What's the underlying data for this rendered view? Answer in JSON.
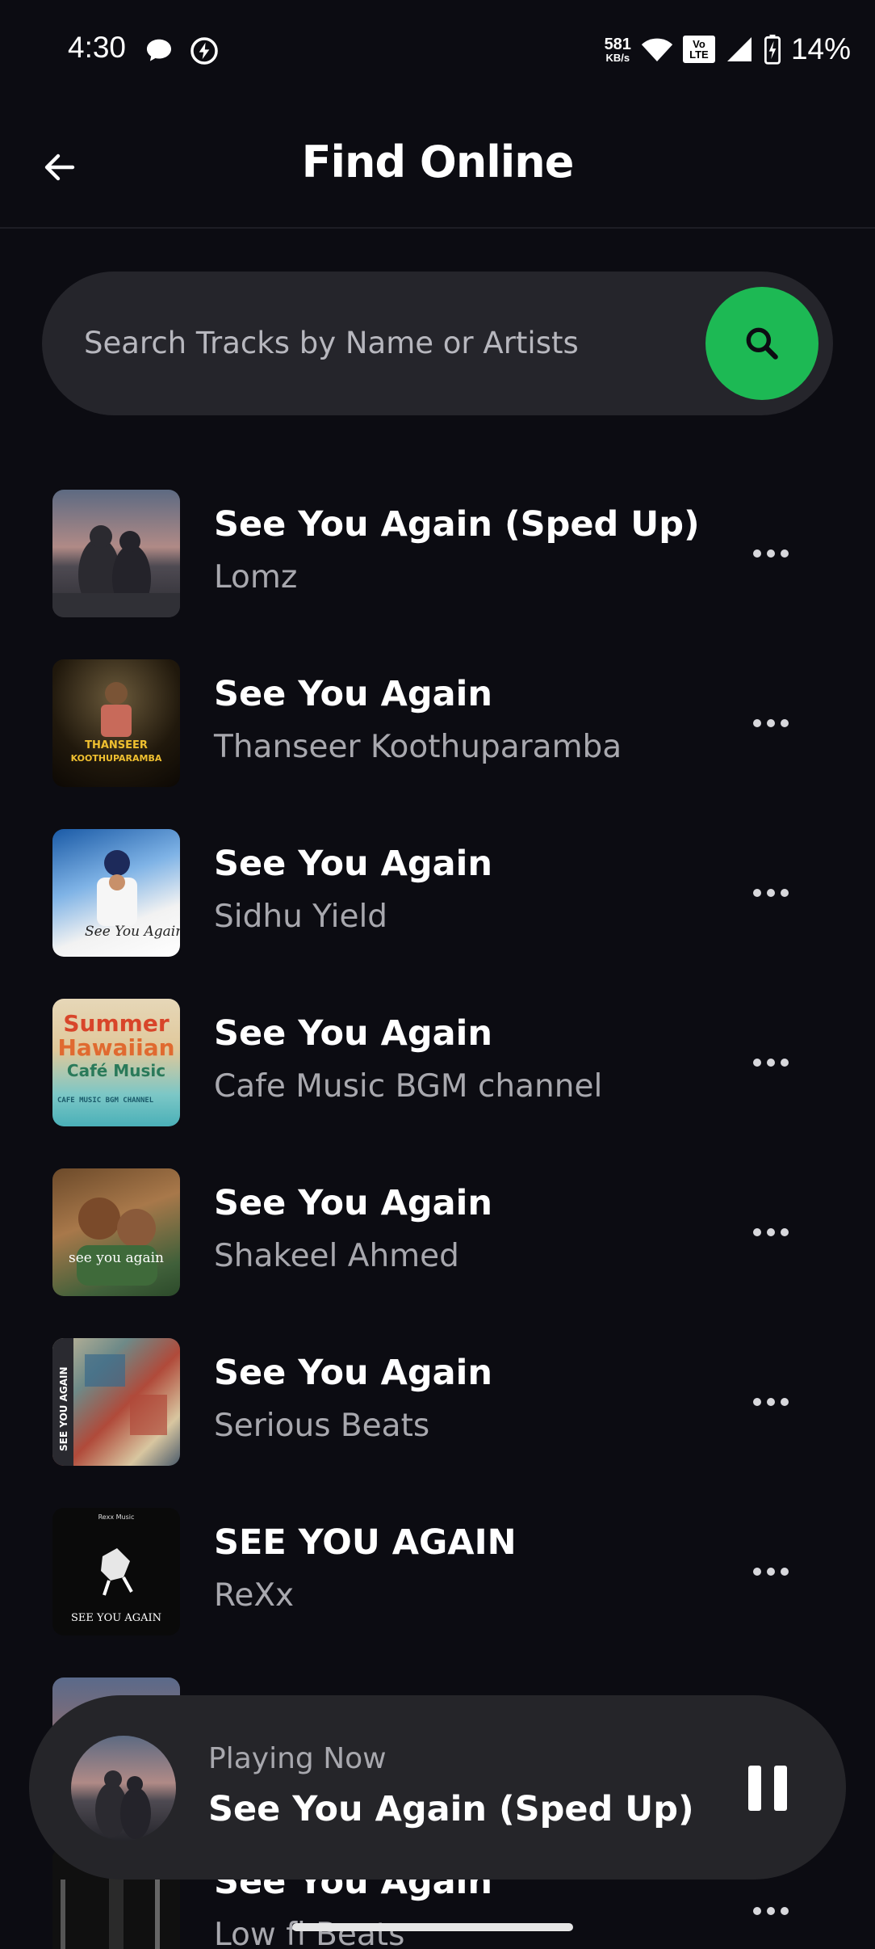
{
  "status_bar": {
    "time": "4:30",
    "net_speed_value": "581",
    "net_speed_unit": "KB/s",
    "volte_top": "Vo",
    "volte_bottom": "LTE",
    "battery_percent": "14%",
    "icons": [
      "chat-bubble-icon",
      "bolt-circle-icon",
      "wifi-icon",
      "volte-icon",
      "cell-signal-icon",
      "battery-charging-icon"
    ]
  },
  "header": {
    "title": "Find Online",
    "back_icon": "arrow-left-icon"
  },
  "search": {
    "placeholder": "Search Tracks by Name or Artists",
    "value": "",
    "button_icon": "search-icon",
    "accent_color": "#1db954"
  },
  "tracks": [
    {
      "title": "See You Again (Sped Up)",
      "artist": "Lomz"
    },
    {
      "title": "See You Again",
      "artist": "Thanseer Koothuparamba"
    },
    {
      "title": "See You Again",
      "artist": "Sidhu Yield"
    },
    {
      "title": "See You Again",
      "artist": "Cafe Music BGM channel"
    },
    {
      "title": "See You Again",
      "artist": "Shakeel Ahmed"
    },
    {
      "title": "See You Again",
      "artist": "Serious Beats"
    },
    {
      "title": "SEE YOU AGAIN",
      "artist": "ReXx"
    },
    {
      "title": "",
      "artist": ""
    },
    {
      "title": "See You Again",
      "artist": "Low fi Beats"
    }
  ],
  "album_art_text": {
    "art2_top": "THANSEER",
    "art2_bottom": "KOOTHUPARAMBA",
    "art3": "See You Again",
    "art4_line1": "Summer",
    "art4_line2": "Hawaiian",
    "art4_line3": "Café Music",
    "art4_small": "CAFE MUSIC BGM CHANNEL",
    "art5": "see you again",
    "art6": "SEE YOU AGAIN",
    "art7_top": "Rexx Music",
    "art7_bottom": "SEE YOU AGAIN"
  },
  "now_playing": {
    "label": "Playing Now",
    "title": "See You Again (Sped Up)",
    "control_icon": "pause-icon"
  }
}
